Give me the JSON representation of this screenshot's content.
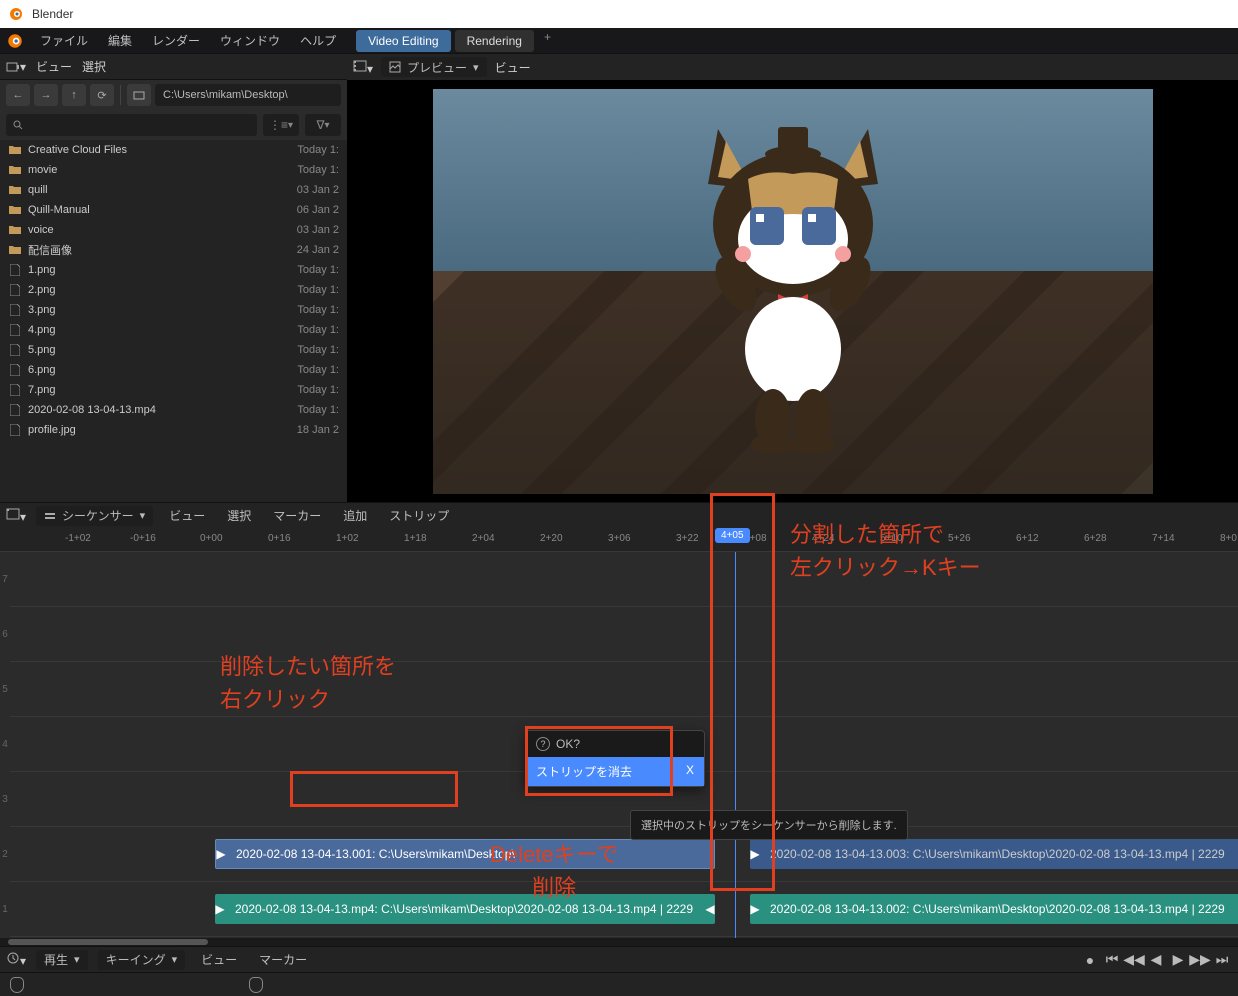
{
  "app_title": "Blender",
  "menubar": {
    "items": [
      "ファイル",
      "編集",
      "レンダー",
      "ウィンドウ",
      "ヘルプ"
    ],
    "tabs": [
      {
        "label": "Video Editing",
        "active": true
      },
      {
        "label": "Rendering",
        "active": false
      }
    ]
  },
  "filebrowser": {
    "header_items": [
      "ビュー",
      "選択"
    ],
    "path": "C:\\Users\\mikam\\Desktop\\",
    "display_dropdown": "⋮≡",
    "filter_dropdown": "∇",
    "files": [
      {
        "type": "folder",
        "name": "Creative Cloud Files",
        "date": "Today 1:"
      },
      {
        "type": "folder",
        "name": "movie",
        "date": "Today 1:"
      },
      {
        "type": "folder",
        "name": "quill",
        "date": "03 Jan 2"
      },
      {
        "type": "folder",
        "name": "Quill-Manual",
        "date": "06 Jan 2"
      },
      {
        "type": "folder",
        "name": "voice",
        "date": "03 Jan 2"
      },
      {
        "type": "folder",
        "name": "配信画像",
        "date": "24 Jan 2"
      },
      {
        "type": "file",
        "name": "1.png",
        "date": "Today 1:"
      },
      {
        "type": "file",
        "name": "2.png",
        "date": "Today 1:"
      },
      {
        "type": "file",
        "name": "3.png",
        "date": "Today 1:"
      },
      {
        "type": "file",
        "name": "4.png",
        "date": "Today 1:"
      },
      {
        "type": "file",
        "name": "5.png",
        "date": "Today 1:"
      },
      {
        "type": "file",
        "name": "6.png",
        "date": "Today 1:"
      },
      {
        "type": "file",
        "name": "7.png",
        "date": "Today 1:"
      },
      {
        "type": "file",
        "name": "2020-02-08 13-04-13.mp4",
        "date": "Today 1:"
      },
      {
        "type": "file",
        "name": "profile.jpg",
        "date": "18 Jan 2"
      }
    ]
  },
  "preview": {
    "dropdown_label": "プレビュー",
    "view_label": "ビュー"
  },
  "sequencer": {
    "dropdown_label": "シーケンサー",
    "menus": [
      "ビュー",
      "選択",
      "マーカー",
      "追加",
      "ストリップ"
    ],
    "ruler_ticks": [
      "-1+02",
      "-0+16",
      "0+00",
      "0+16",
      "1+02",
      "1+18",
      "2+04",
      "2+20",
      "3+06",
      "3+22",
      "4+08",
      "4+24",
      "5+10",
      "5+26",
      "6+12",
      "6+28",
      "7+14",
      "8+0"
    ],
    "playhead_label": "4+05",
    "track_nums": [
      "7",
      "6",
      "5",
      "4",
      "3",
      "2",
      "1"
    ],
    "strips": {
      "video1": "2020-02-08 13-04-13.001: C:\\Users\\mikam\\Desktop\\",
      "video2": "2020-02-08 13-04-13.003: C:\\Users\\mikam\\Desktop\\2020-02-08 13-04-13.mp4 | 2229",
      "audio1": "2020-02-08 13-04-13.mp4: C:\\Users\\mikam\\Desktop\\2020-02-08 13-04-13.mp4 | 2229",
      "audio2": "2020-02-08 13-04-13.002: C:\\Users\\mikam\\Desktop\\2020-02-08 13-04-13.mp4 | 2229"
    }
  },
  "context_menu": {
    "title": "OK?",
    "item": "ストリップを消去",
    "shortcut": "X"
  },
  "tooltip": "選択中のストリップをシーケンサーから削除します.",
  "annotations": {
    "text1": "削除したい箇所を\n右クリック",
    "text2": "分割した箇所で\n左クリック→Kキー",
    "text3": "Deleteキーで\n削除"
  },
  "bottombar": {
    "playback": "再生",
    "keying": "キーイング",
    "menus": [
      "ビュー",
      "マーカー"
    ]
  }
}
